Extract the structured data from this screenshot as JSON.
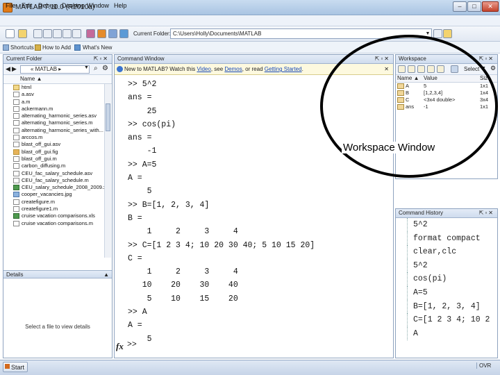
{
  "window": {
    "title": "MATLAB 7.10.0 (R2010a)",
    "min": "–",
    "max": "□",
    "close": "✕"
  },
  "menu": [
    "File",
    "Edit",
    "Debug",
    "Desktop",
    "Window",
    "Help"
  ],
  "toolbar": {
    "current_folder_label": "Current Folder:",
    "path": "C:\\Users\\Holly\\Documents\\MATLAB"
  },
  "shortcuts": {
    "s1": "Shortcuts",
    "s2": "How to Add",
    "s3": "What's New"
  },
  "current_folder": {
    "title": "Current Folder",
    "path": "« MATLAB ▸",
    "column": "Name ▲",
    "files": [
      "html",
      "a.asv",
      "a.m",
      "ackermann.m",
      "alternating_harmonic_series.asv",
      "alternating_harmonic_series.m",
      "alternating_harmonic_series_with...",
      "arccos.m",
      "blast_off_gui.asv",
      "blast_off_gui.fig",
      "blast_off_gui.m",
      "carbon_diffusing.m",
      "CEU_fac_salary_schedule.asv",
      "CEU_fac_salary_schedule.m",
      "CEU_salary_schedule_2008_2009.xls",
      "cooper_vacancies.jpg",
      "createfigure.m",
      "createfigure1.m",
      "cruise vacation comparisons.xls",
      "cruise vacation comparisons.m"
    ]
  },
  "details": {
    "title": "Details",
    "placeholder": "Select a file to view details"
  },
  "command_window": {
    "title": "Command Window",
    "info": {
      "pre": "New to MATLAB? Watch this ",
      "video": "Video",
      "see": ", see ",
      "demos": "Demos",
      "or": ", or read ",
      "getting_started": "Getting Started",
      "end": "."
    },
    "lines": [
      ">> 5^2",
      "ans =",
      "    25",
      ">> cos(pi)",
      "ans =",
      "    -1",
      ">> A=5",
      "A =",
      "    5",
      ">> B=[1, 2, 3, 4]",
      "B =",
      "    1     2     3     4",
      ">> C=[1 2 3 4; 10 20 30 40; 5 10 15 20]",
      "C =",
      "    1     2     3     4",
      "   10    20    30    40",
      "    5    10    15    20",
      ">> A",
      "A =",
      "    5"
    ],
    "prompt": ">>",
    "fx": "fx"
  },
  "workspace": {
    "title": "Workspace",
    "select": "Select",
    "headers": {
      "name": "Name ▲",
      "value": "Value",
      "size": "Size"
    },
    "rows": [
      {
        "name": "A",
        "value": "5",
        "size": "1x1"
      },
      {
        "name": "B",
        "value": "[1,2,3,4]",
        "size": "1x4"
      },
      {
        "name": "C",
        "value": "<3x4 double>",
        "size": "3x4"
      },
      {
        "name": "ans",
        "value": "-1",
        "size": "1x1"
      }
    ]
  },
  "command_history": {
    "title": "Command History",
    "lines": [
      "5^2",
      "format compact",
      "clear,clc",
      "5^2",
      "cos(pi)",
      "A=5",
      "B=[1, 2, 3, 4]",
      "C=[1 2 3 4; 10 2",
      "A"
    ]
  },
  "status": {
    "start": "Start",
    "ovr": "OVR"
  },
  "annotation": {
    "label": "Workspace Window"
  }
}
